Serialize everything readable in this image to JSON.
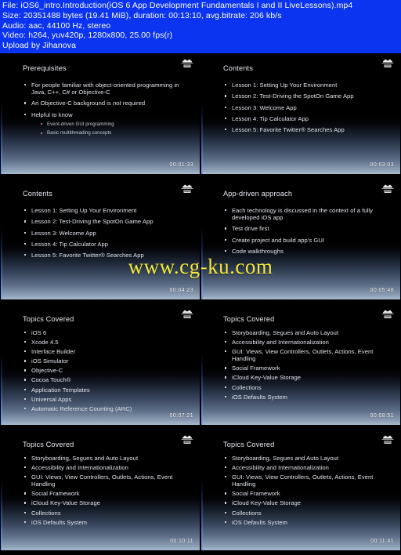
{
  "header": {
    "lines": [
      "File: iOS6_intro.Introduction(iOS 6 App Development Fundamentals I and II LiveLessons).mp4",
      "Size: 20351488 bytes (19.41 MiB), duration: 00:13:10, avg.bitrate: 206 kb/s",
      "Audio: aac, 44100 Hz, stereo",
      "Video: h264, yuv420p, 1280x800, 25.00 fps(r)",
      "Upload by Jihanova"
    ],
    "background_color": "#0a34ef",
    "text_color": "#ffffff"
  },
  "watermark": {
    "text": "www.cg-ku.com",
    "color": "#f2e93c"
  },
  "logo": {
    "name": "deitel-logo"
  },
  "thumbnails": [
    {
      "title": "Prerequisites",
      "timestamp": "00:01:33",
      "bullets": [
        {
          "text": "For people familiar with object-oriented programming in Java, C++, C# or Objective-C"
        },
        {
          "text": "An Objective-C background is not required"
        },
        {
          "text": "Helpful to know",
          "sub": [
            "Event-driven GUI programming",
            "Basic multithreading concepts"
          ]
        }
      ]
    },
    {
      "title": "Contents",
      "timestamp": "00:03:03",
      "bullets": [
        {
          "text": "Lesson 1: Setting Up Your Environment"
        },
        {
          "text": "Lesson 2: Test-Driving the SpotOn Game App"
        },
        {
          "text": "Lesson 3: Welcome App"
        },
        {
          "text": "Lesson 4: Tip Calculator App"
        },
        {
          "text": "Lesson 5: Favorite Twitter® Searches App"
        }
      ]
    },
    {
      "title": "Contents",
      "timestamp": "00:04:23",
      "bullets": [
        {
          "text": "Lesson 1: Setting Up Your Environment"
        },
        {
          "text": "Lesson 2: Test-Driving the SpotOn Game App"
        },
        {
          "text": "Lesson 3: Welcome App"
        },
        {
          "text": "Lesson 4: Tip Calculator App"
        },
        {
          "text": "Lesson 5: Favorite Twitter® Searches App"
        }
      ]
    },
    {
      "title": "App-driven approach",
      "timestamp": "00:05:48",
      "bullets": [
        {
          "text": "Each technology is discussed in the context of a fully developed iOS app"
        },
        {
          "text": "Test drive first"
        },
        {
          "text": "Create project and build app’s GUI"
        },
        {
          "text": "Code walkthroughs"
        }
      ]
    },
    {
      "title": "Topics Covered",
      "timestamp": "00:07:21",
      "bullets": [
        {
          "text": "iOS 6"
        },
        {
          "text": "Xcode 4.5"
        },
        {
          "text": "Interface Builder"
        },
        {
          "text": "iOS Simulator"
        },
        {
          "text": "Objective-C"
        },
        {
          "text": "Cocoa Touch®"
        },
        {
          "text": "Application Templates"
        },
        {
          "text": "Universal Apps"
        },
        {
          "text": "Automatic Reference Counting (ARC)"
        }
      ]
    },
    {
      "title": "Topics Covered",
      "timestamp": "00:08:51",
      "bullets": [
        {
          "text": "Storyboarding, Segues and Auto Layout"
        },
        {
          "text": "Accessibility and Internationalization"
        },
        {
          "text": "GUI: Views, View Controllers, Outlets, Actions, Event Handling"
        },
        {
          "text": "Social Framework"
        },
        {
          "text": "iCloud Key-Value Storage"
        },
        {
          "text": "Collections"
        },
        {
          "text": "iOS Defaults System"
        }
      ]
    },
    {
      "title": "Topics Covered",
      "timestamp": "00:10:11",
      "bullets": [
        {
          "text": "Storyboarding, Segues and Auto Layout"
        },
        {
          "text": "Accessibility and Internationalization"
        },
        {
          "text": "GUI: Views, View Controllers, Outlets, Actions, Event Handling"
        },
        {
          "text": "Social Framework"
        },
        {
          "text": "iCloud Key-Value Storage"
        },
        {
          "text": "Collections"
        },
        {
          "text": "iOS Defaults System"
        }
      ]
    },
    {
      "title": "Topics Covered",
      "timestamp": "00:11:41",
      "bullets": [
        {
          "text": "Storyboarding, Segues and Auto Layout"
        },
        {
          "text": "Accessibility and Internationalization"
        },
        {
          "text": "GUI: Views, View Controllers, Outlets, Actions, Event Handling"
        },
        {
          "text": "Social Framework"
        },
        {
          "text": "iCloud Key-Value Storage"
        },
        {
          "text": "Collections"
        },
        {
          "text": "iOS Defaults System"
        }
      ]
    }
  ]
}
